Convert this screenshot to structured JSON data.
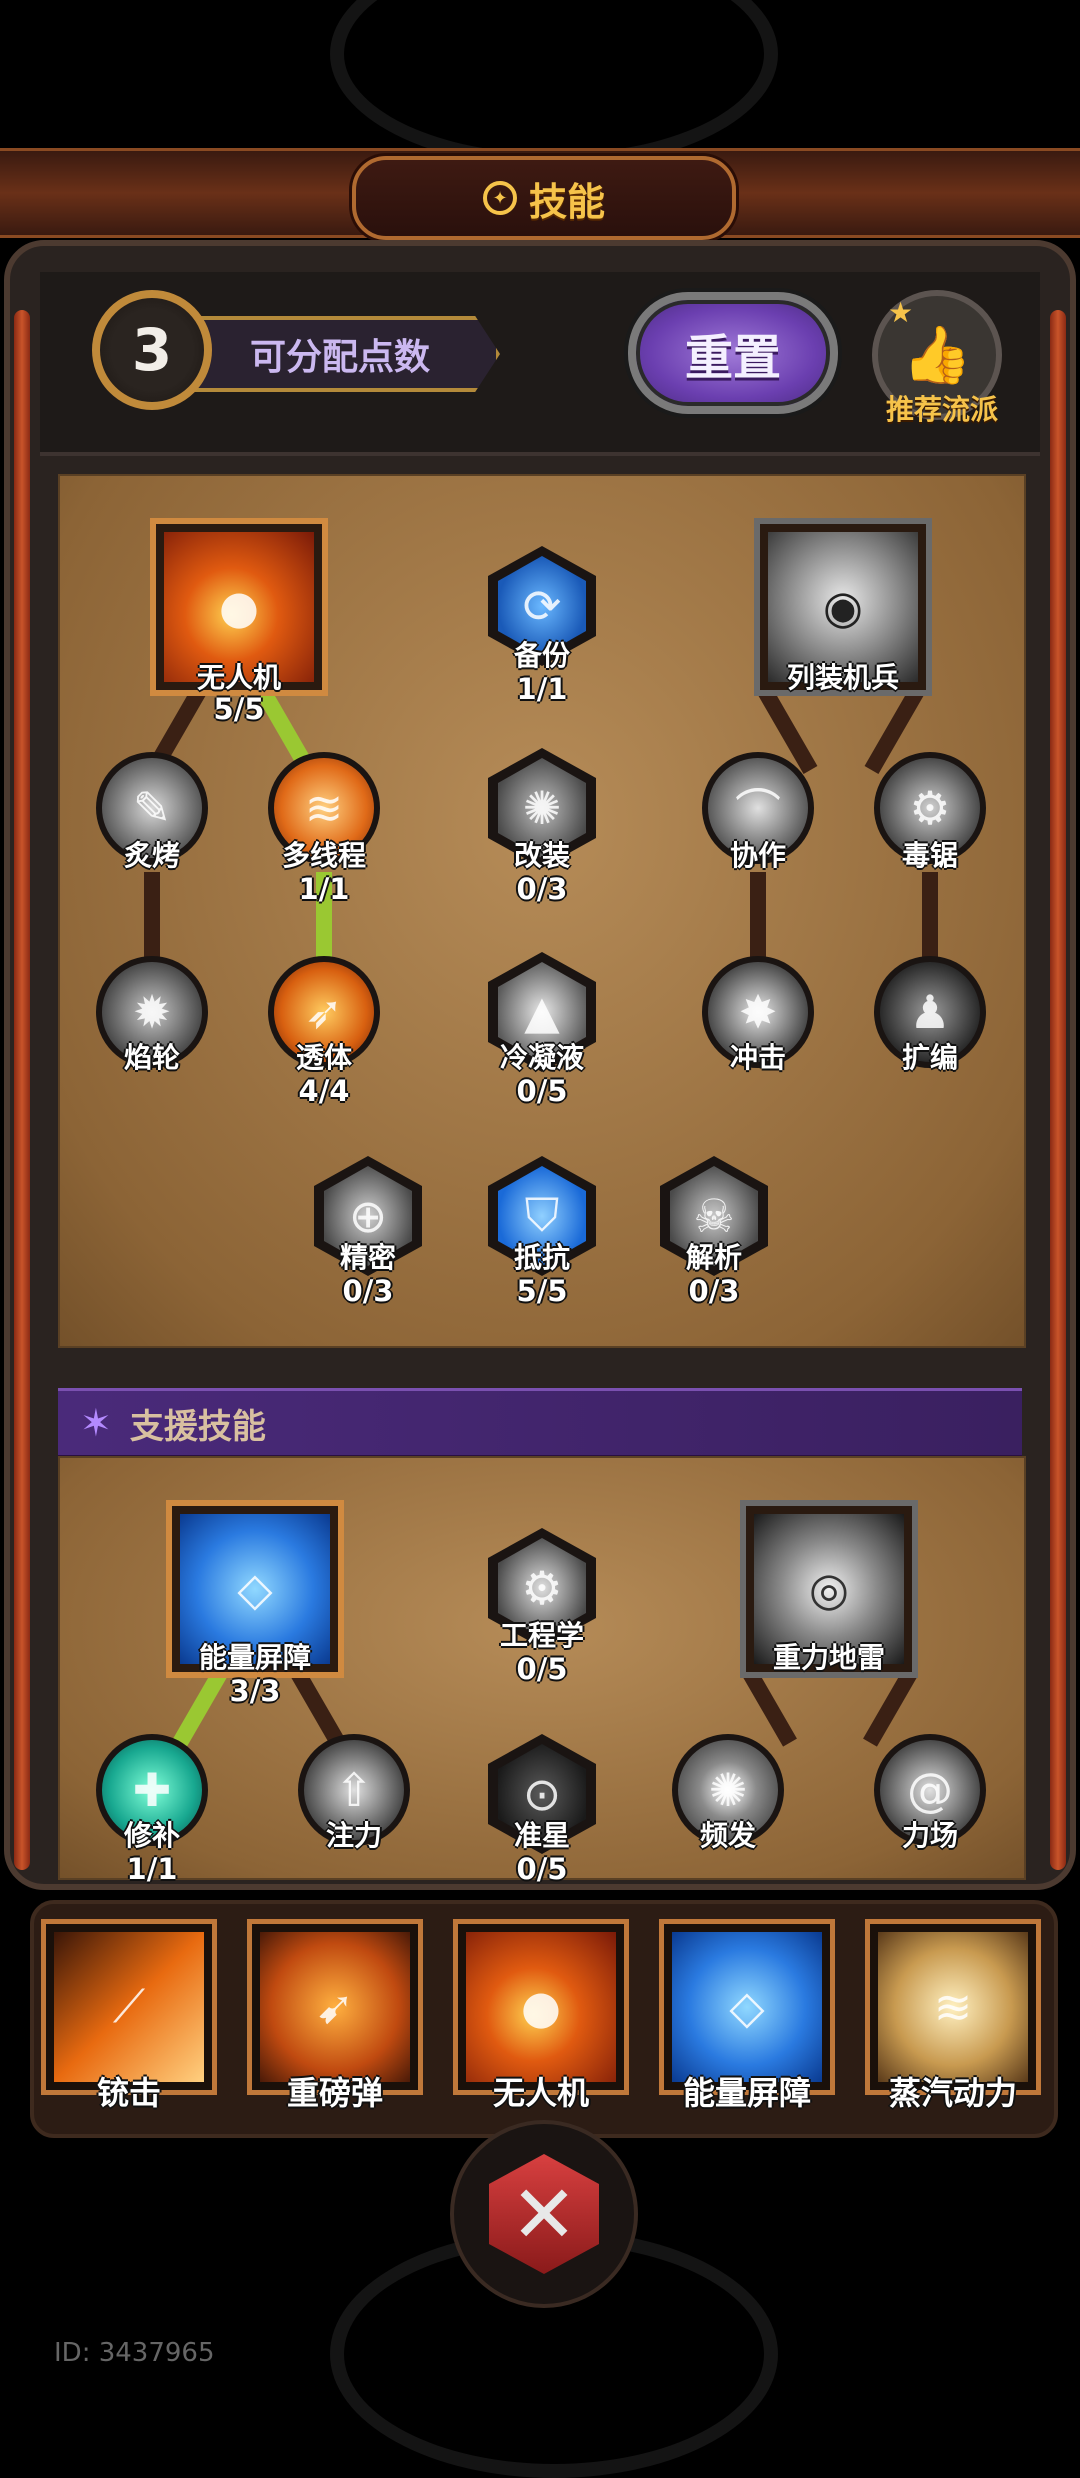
{
  "header": {
    "title": "技能",
    "available_points": "3",
    "available_points_label": "可分配点数",
    "reset_label": "重置",
    "recommended_label": "推荐流派"
  },
  "skill_tree": {
    "drone": {
      "name": "无人机",
      "count": "5/5"
    },
    "backup": {
      "name": "备份",
      "count": "1/1"
    },
    "armored_soldier": {
      "name": "列装机兵"
    },
    "roast": {
      "name": "炙烤"
    },
    "multithread": {
      "name": "多线程",
      "count": "1/1"
    },
    "modify": {
      "name": "改装",
      "count": "0/3"
    },
    "cooperate": {
      "name": "协作"
    },
    "poison_saw": {
      "name": "毒锯"
    },
    "flame_wheel": {
      "name": "焰轮"
    },
    "penetrate": {
      "name": "透体",
      "count": "4/4"
    },
    "condensate": {
      "name": "冷凝液",
      "count": "0/5"
    },
    "impact": {
      "name": "冲击"
    },
    "expand": {
      "name": "扩编"
    },
    "precision": {
      "name": "精密",
      "count": "0/3"
    },
    "resist": {
      "name": "抵抗",
      "count": "5/5"
    },
    "analyze": {
      "name": "解析",
      "count": "0/3"
    }
  },
  "support": {
    "title": "支援技能",
    "energy_shield": {
      "name": "能量屏障",
      "count": "3/3"
    },
    "engineering": {
      "name": "工程学",
      "count": "0/5"
    },
    "gravity_mine": {
      "name": "重力地雷"
    },
    "repair": {
      "name": "修补",
      "count": "1/1"
    },
    "focus": {
      "name": "注力"
    },
    "crosshair": {
      "name": "准星",
      "count": "0/5"
    },
    "frequent": {
      "name": "频发"
    },
    "force_field": {
      "name": "力场"
    }
  },
  "equipped": [
    "铳击",
    "重磅弹",
    "无人机",
    "能量屏障",
    "蒸汽动力"
  ],
  "footer": {
    "id_text": "ID: 3437965"
  },
  "colors": {
    "accent_gold": "#f6c34a",
    "active_line": "#9ac832",
    "reset_purple": "#6b3fb0"
  }
}
